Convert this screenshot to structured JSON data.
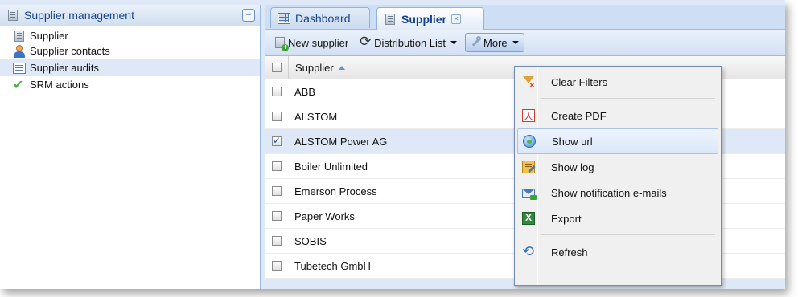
{
  "left_panel": {
    "title": "Supplier management",
    "items": [
      {
        "label": "Supplier\nSupplier contacts"
      },
      {
        "label": "Supplier audits"
      },
      {
        "label": "SRM actions"
      }
    ],
    "supplier_label": "Supplier",
    "contacts_label": "Supplier contacts",
    "collapse_symbol": "−"
  },
  "tabs": [
    {
      "label": "Dashboard",
      "icon": "grid-icon",
      "active": false
    },
    {
      "label": "Supplier",
      "icon": "building-icon",
      "active": true
    }
  ],
  "toolbar": {
    "new_supplier": "New supplier",
    "distribution_list": "Distribution List",
    "more": "More"
  },
  "grid": {
    "column_header": "Supplier",
    "sort": "ascending",
    "rows": [
      {
        "name": "ABB",
        "checked": false
      },
      {
        "name": "ALSTOM",
        "checked": false
      },
      {
        "name": "ALSTOM Power AG",
        "checked": true
      },
      {
        "name": "Boiler Unlimited",
        "checked": false
      },
      {
        "name": "Emerson Process",
        "checked": false
      },
      {
        "name": "Paper Works",
        "checked": false
      },
      {
        "name": "SOBIS",
        "checked": false
      },
      {
        "name": "Tubetech GmbH",
        "checked": false
      }
    ]
  },
  "more_menu": {
    "items": [
      {
        "label": "Clear Filters",
        "icon": "clear-filter-icon"
      },
      {
        "label": "Create PDF",
        "icon": "pdf-icon"
      },
      {
        "label": "Show url",
        "icon": "globe-icon"
      },
      {
        "label": "Show log",
        "icon": "log-icon"
      },
      {
        "label": "Show notification e-mails",
        "icon": "mail-icon"
      },
      {
        "label": "Export",
        "icon": "excel-icon"
      },
      {
        "label": "Refresh",
        "icon": "refresh-icon"
      }
    ],
    "highlighted": "Show url"
  },
  "colors": {
    "panel_border": "#99bbe8",
    "selection": "#dfe8f6",
    "title_text": "#15428b"
  }
}
